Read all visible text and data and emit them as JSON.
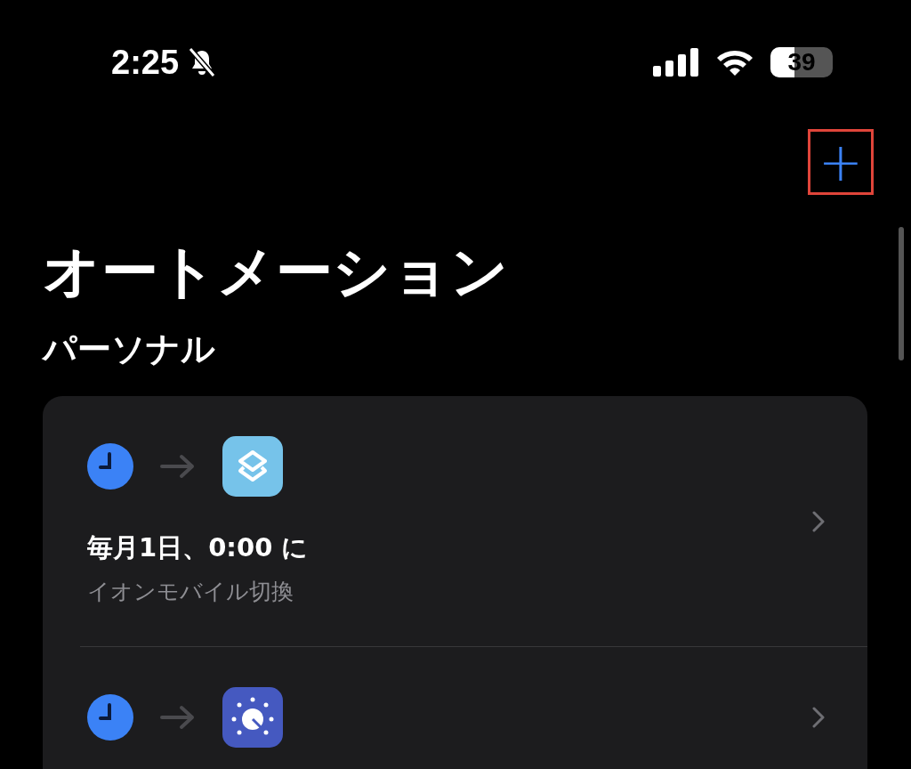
{
  "status_bar": {
    "time": "2:25",
    "silent": true,
    "battery": "39"
  },
  "add_button": {
    "label": "+",
    "highlighted": true
  },
  "title": "オートメーション",
  "section": "パーソナル",
  "automations": [
    {
      "trigger": {
        "kind": "clock"
      },
      "action": {
        "kind": "shortcuts"
      },
      "title": "毎月1日、0:00 に",
      "subtitle": "イオンモバイル切換"
    },
    {
      "trigger": {
        "kind": "clock"
      },
      "action": {
        "kind": "dial"
      }
    }
  ]
}
